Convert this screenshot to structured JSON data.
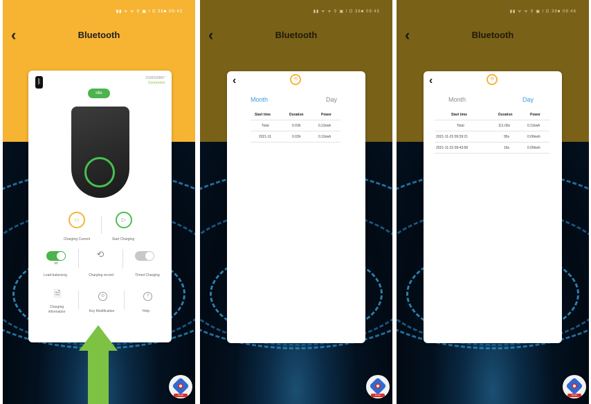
{
  "screen1": {
    "title": "Bluetooth",
    "status_bar": "▮▮ ᯤ ᯤ ⚲  ▣ Ɩ O 38■ 09:43",
    "serial": "2330000887",
    "connection": "Connected",
    "state_badge": "Idle",
    "items": [
      {
        "label": "Charging Current"
      },
      {
        "label": "Start Charging"
      },
      {
        "label": "Load balancing"
      },
      {
        "label": "Charging record"
      },
      {
        "label": "Timed Charging"
      },
      {
        "label": "Charging information"
      },
      {
        "label": "Key Modification"
      },
      {
        "label": "Help"
      }
    ],
    "toggle_load_label": "on"
  },
  "screen2": {
    "title": "Bluetooth",
    "status_bar": "▮▮ ᯤ ᯤ ⚲  ▣ Ɩ O 38■ 09:45",
    "tabs": {
      "month": "Month",
      "day": "Day",
      "active": "month"
    },
    "headers": [
      "Start time",
      "Duration",
      "Power"
    ],
    "rows": [
      [
        "Total",
        "0.03h",
        "0.11kwh"
      ],
      [
        "2021-11",
        "0.03h",
        "0.11kwh"
      ]
    ]
  },
  "screen3": {
    "title": "Bluetooth",
    "status_bar": "▮▮ ᯤ ᯤ ⚲  ▣ Ɩ O 38■ 09:46",
    "tabs": {
      "month": "Month",
      "day": "Day",
      "active": "day"
    },
    "headers": [
      "Start time",
      "Duration",
      "Power"
    ],
    "rows": [
      [
        "Total",
        "111.00s",
        "0.11kwh"
      ],
      [
        "2021-11-23 09:39:21",
        "95s",
        "0.06kwh"
      ],
      [
        "2021-11-23 09:43:58",
        "16s",
        "0.05kwh"
      ]
    ]
  },
  "badge_label": "Flutter",
  "colors": {
    "header_active": "#f6b432",
    "header_dimmed": "#7a6118",
    "tab_active": "#3a9be0",
    "accent_green": "#4cb34d",
    "arrow": "#7dc243"
  }
}
